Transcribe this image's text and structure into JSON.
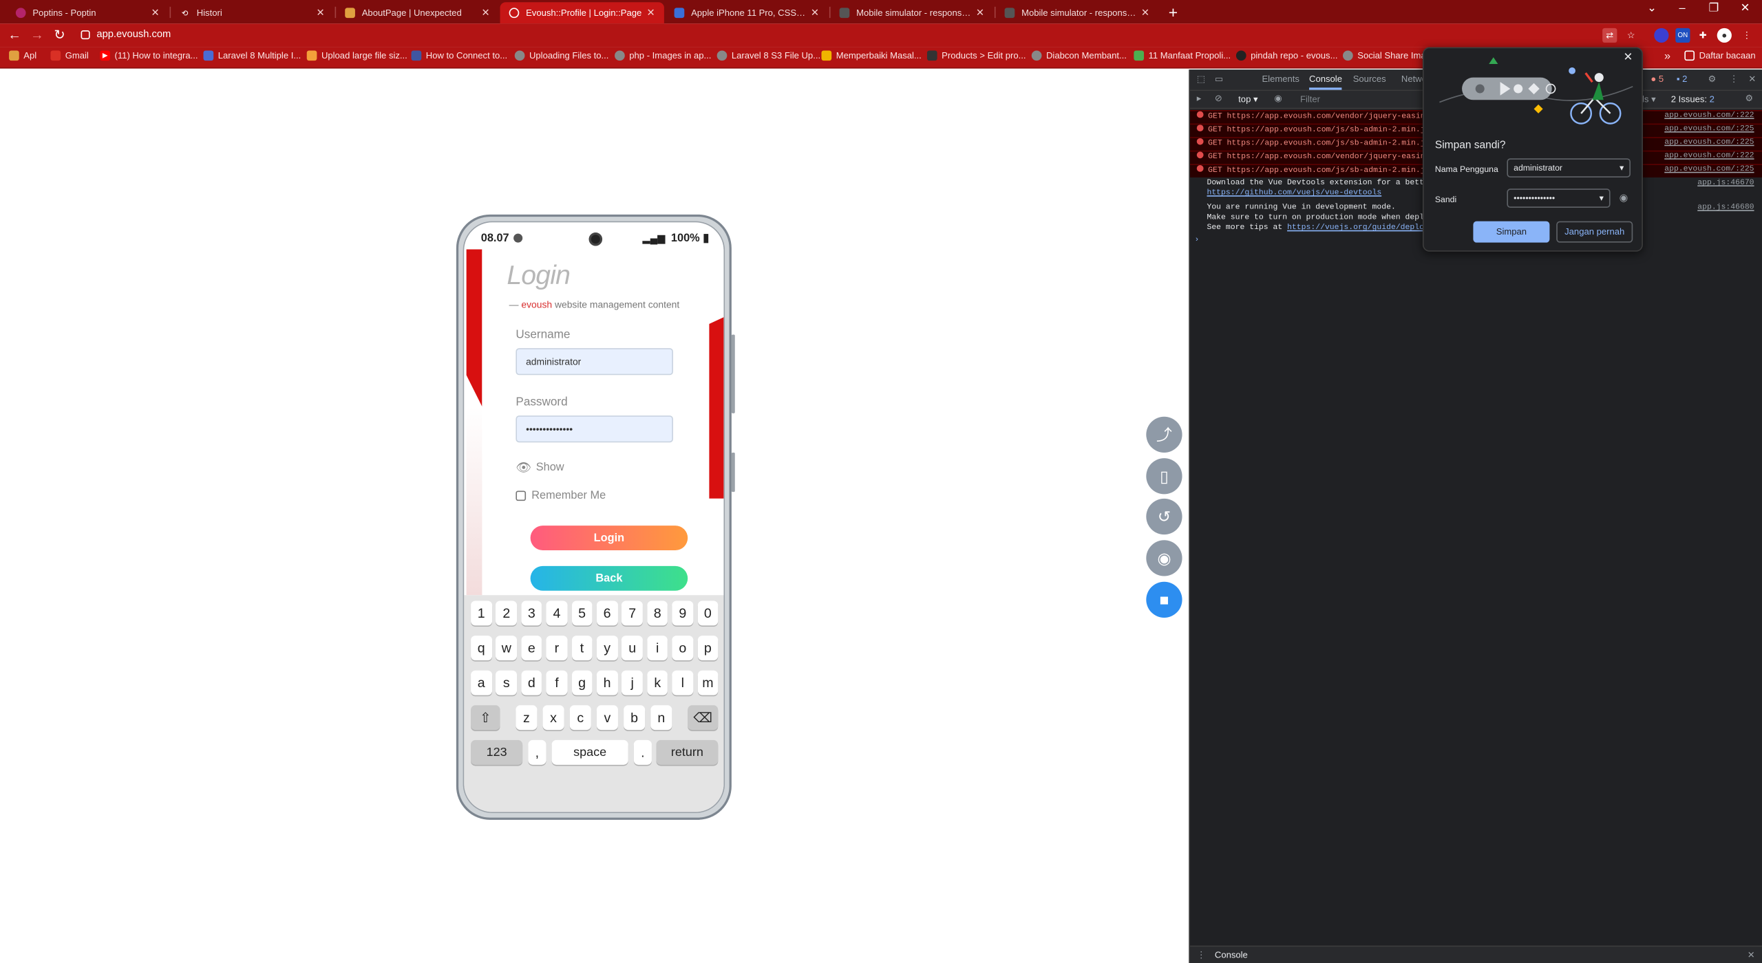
{
  "browser": {
    "tabs": [
      {
        "title": "Poptins - Poptin",
        "icon": "poptin-favicon",
        "color": "#b5246a"
      },
      {
        "title": "Histori",
        "icon": "history-icon",
        "color": "#7e0c0c"
      },
      {
        "title": "AboutPage | Unexpected",
        "icon": "page-favicon",
        "color": "#e0a040"
      },
      {
        "title": "Evoush::Profile | Login::Page",
        "icon": "globe-favicon",
        "color": "#c61616"
      },
      {
        "title": "Apple iPhone 11 Pro, CSS viewp",
        "icon": "page-favicon",
        "color": "#3a6fd8"
      },
      {
        "title": "Mobile simulator - responsive te",
        "icon": "simulator-favicon",
        "color": "#555"
      },
      {
        "title": "Mobile simulator - responsive te",
        "icon": "simulator-favicon",
        "color": "#555"
      }
    ],
    "new_tab": "+",
    "url": "app.evoush.com",
    "bookmarks": [
      {
        "label": "Apl",
        "color": "#e0a040"
      },
      {
        "label": "Gmail",
        "color": "#d93025"
      },
      {
        "label": "(11) How to integra...",
        "color": "#ff0000"
      },
      {
        "label": "Laravel 8 Multiple I...",
        "color": "#4a6cd4"
      },
      {
        "label": "Upload large file siz...",
        "color": "#f3a03a"
      },
      {
        "label": "How to Connect to...",
        "color": "#4056a1"
      },
      {
        "label": "Uploading Files to...",
        "color": "#888"
      },
      {
        "label": "php - Images in ap...",
        "color": "#888"
      },
      {
        "label": "Laravel 8 S3 File Up...",
        "color": "#888"
      },
      {
        "label": "Memperbaiki Masal...",
        "color": "#f0b400"
      },
      {
        "label": "Products > Edit pro...",
        "color": "#333"
      },
      {
        "label": "Diabcon Membant...",
        "color": "#888"
      },
      {
        "label": "11 Manfaat Propoli...",
        "color": "#4caf50"
      },
      {
        "label": "pindah repo - evous...",
        "color": "#222"
      },
      {
        "label": "Social Share Imag",
        "color": "#888"
      }
    ],
    "bookmarks_more": "»",
    "reading_list": "Daftar bacaan"
  },
  "phone": {
    "time": "08.07",
    "battery": "100%",
    "page": {
      "title": "Login",
      "subtitle_prefix": "— ",
      "subtitle_brand": "evoush",
      "subtitle_rest": " website management content",
      "username_label": "Username",
      "username_value": "administrator",
      "password_label": "Password",
      "password_value": "••••••••••••••",
      "show_label": "Show",
      "remember_label": "Remember Me",
      "login_button": "Login",
      "back_button": "Back"
    },
    "keyboard": {
      "row1": [
        "1",
        "2",
        "3",
        "4",
        "5",
        "6",
        "7",
        "8",
        "9",
        "0"
      ],
      "row2": [
        "q",
        "w",
        "e",
        "r",
        "t",
        "y",
        "u",
        "i",
        "o",
        "p"
      ],
      "row3": [
        "a",
        "s",
        "d",
        "f",
        "g",
        "h",
        "j",
        "k",
        "l",
        "m"
      ],
      "row4": [
        "z",
        "x",
        "c",
        "v",
        "b",
        "n"
      ],
      "shift": "⇧",
      "backspace": "⌫",
      "numbers": "123",
      "comma": ",",
      "space": "space",
      "period": ".",
      "return": "return"
    }
  },
  "devtools": {
    "tabs": [
      "Elements",
      "Console",
      "Sources",
      "Network"
    ],
    "active_tab": "Console",
    "errors_count": "5",
    "messages_count": "2",
    "issues_label": "2 Issues:",
    "issues_count": "2",
    "levels_label": "els",
    "context": "top",
    "filter_placeholder": "Filter",
    "logs": [
      {
        "type": "error",
        "text": "GET https://app.evoush.com/vendor/jquery-easing/",
        "src": "app.evoush.com/:222"
      },
      {
        "type": "error",
        "text": "GET https://app.evoush.com/js/sb-admin-2.min.js",
        "src": "app.evoush.com/:225"
      },
      {
        "type": "error",
        "text": "GET https://app.evoush.com/js/sb-admin-2.min.js",
        "src": "app.evoush.com/:225"
      },
      {
        "type": "error",
        "text": "GET https://app.evoush.com/vendor/jquery-easing/",
        "src": "app.evoush.com/:222"
      },
      {
        "type": "error",
        "text": "GET https://app.evoush.com/js/sb-admin-2.min.js",
        "src": "app.evoush.com/:225"
      }
    ],
    "info1_line1": "Download the Vue Devtools extension for a better",
    "info1_line2": "https://github.com/vuejs/vue-devtools",
    "info1_src": "app.js:46670",
    "info2_line1": "You are running Vue in development mode.",
    "info2_line2": "Make sure to turn on production mode when deploy",
    "info2_line3_prefix": "See more tips at ",
    "info2_line3_link": "https://vuejs.org/guide/deploy",
    "info2_src": "app.js:46680",
    "prompt": "›",
    "drawer_tab": "Console"
  },
  "password_popup": {
    "title": "Simpan sandi?",
    "username_label": "Nama Pengguna",
    "username_value": "administrator",
    "password_label": "Sandi",
    "password_value": "••••••••••••••",
    "save_button": "Simpan",
    "never_button": "Jangan pernah",
    "accent_color": "#8ab4f8"
  }
}
